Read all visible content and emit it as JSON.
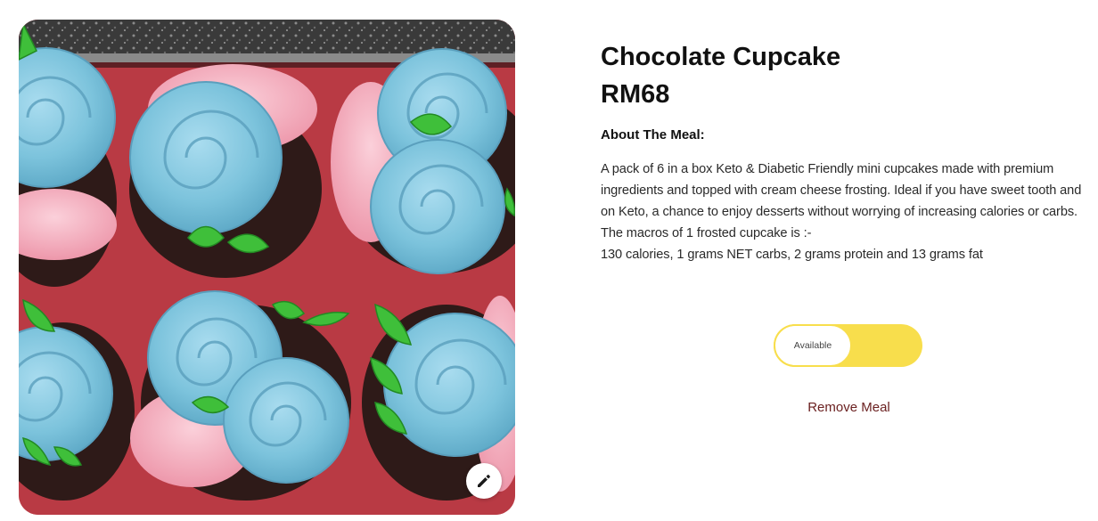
{
  "meal": {
    "title": "Chocolate Cupcake",
    "price": "RM68",
    "about_heading": "About The Meal:",
    "description_lines": [
      "A pack of 6 in a box Keto & Diabetic Friendly mini cupcakes made with premium ingredients and topped with cream cheese frosting. Ideal if you have sweet tooth and on Keto, a chance to enjoy desserts without worrying of increasing calories or carbs.",
      "The macros of 1 frosted cupcake is :-",
      "130 calories, 1 grams NET carbs, 2 grams protein and 13 grams fat"
    ]
  },
  "availability": {
    "label": "Available",
    "on": true
  },
  "actions": {
    "remove_label": "Remove Meal",
    "edit_icon": "pencil-icon"
  },
  "colors": {
    "toggle_track": "#f8de4c",
    "remove_text": "#6b2121",
    "frosting_blue": "#7cc3dc",
    "frosting_pink": "#f2a2b4",
    "tray_red": "#b93a44"
  }
}
